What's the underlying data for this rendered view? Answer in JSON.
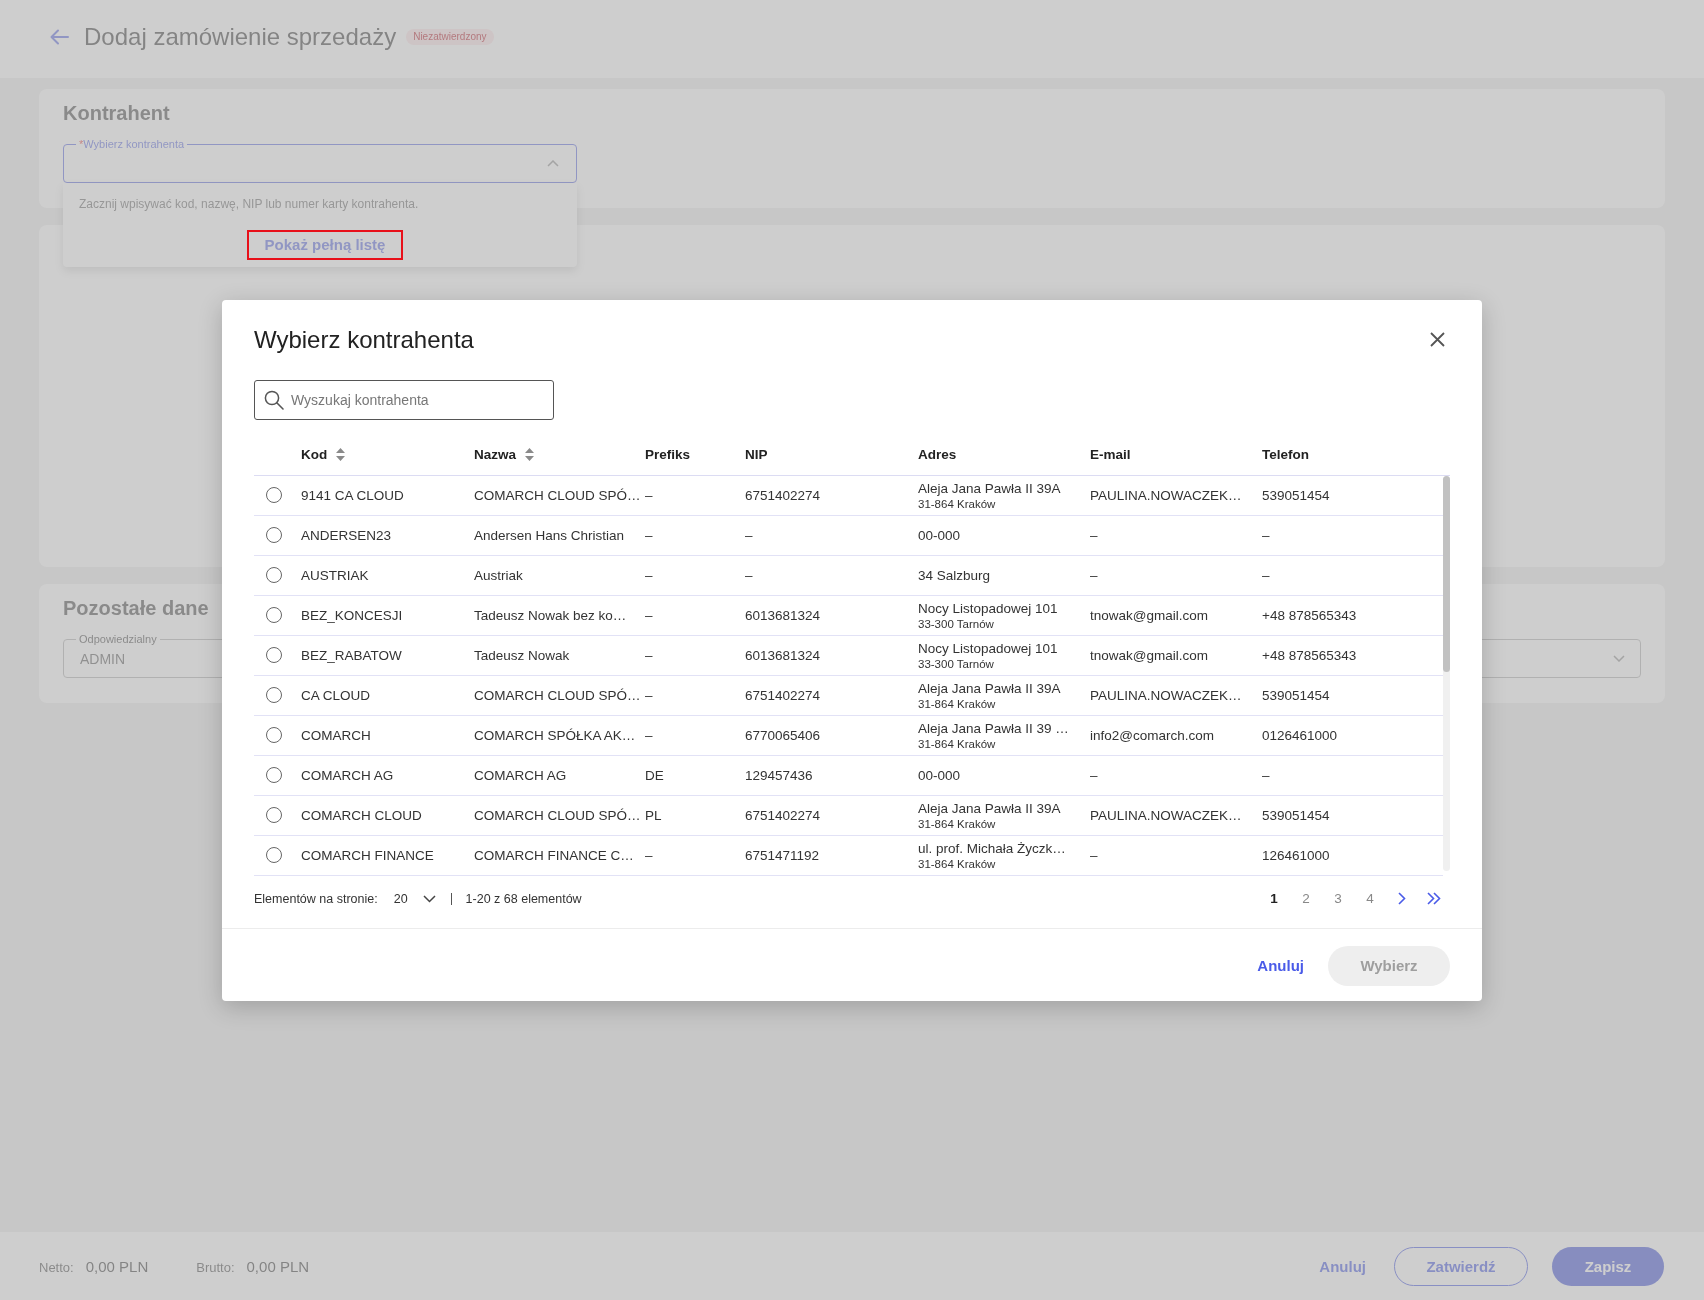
{
  "header": {
    "title": "Dodaj zamówienie sprzedaży",
    "status_badge": "Niezatwierdzony"
  },
  "contractor_section": {
    "title": "Kontrahent",
    "select": {
      "required_mark": "*",
      "label": "Wybierz kontrahenta",
      "expanded": true
    },
    "dropdown": {
      "hint": "Zacznij wpisywać kod, nazwę, NIP lub numer karty kontrahenta.",
      "link": {
        "label": "Pokaż pełną listę",
        "highlighted": true
      }
    }
  },
  "other_section": {
    "title": "Pozostałe dane",
    "fields": [
      {
        "kind": "text",
        "label": "Odpowiedzialny",
        "value": "ADMIN",
        "disabled": true
      },
      {
        "kind": "select"
      }
    ]
  },
  "bottom_bar": {
    "totals": [
      {
        "label": "Netto:",
        "value": "0,00 PLN"
      },
      {
        "label": "Brutto:",
        "value": "0,00 PLN"
      }
    ],
    "buttons": [
      {
        "kind": "link",
        "label": "Anuluj"
      },
      {
        "kind": "outlined",
        "label": "Zatwierdź"
      },
      {
        "kind": "primary",
        "label": "Zapisz"
      }
    ]
  },
  "dialog": {
    "title": "Wybierz kontrahenta",
    "search": {
      "placeholder": "Wyszukaj kontrahenta"
    },
    "table": {
      "columns": [
        {
          "label": "Kod",
          "kind": "sortable"
        },
        {
          "label": "Nazwa",
          "kind": "sortable"
        },
        {
          "label": "Prefiks",
          "kind": "plain"
        },
        {
          "label": "NIP",
          "kind": "plain"
        },
        {
          "label": "Adres",
          "kind": "plain"
        },
        {
          "label": "E-mail",
          "kind": "plain"
        },
        {
          "label": "Telefon",
          "kind": "plain"
        }
      ],
      "rows": [
        {
          "selected": false,
          "cells": [
            "9141 CA CLOUD",
            "COMARCH CLOUD SPÓ…",
            "–",
            "6751402274",
            [
              "Aleja Jana Pawła II 39A",
              "31-864 Kraków"
            ],
            "PAULINA.NOWACZEK…",
            "539051454"
          ]
        },
        {
          "selected": false,
          "cells": [
            "ANDERSEN23",
            "Andersen Hans Christian",
            "–",
            "–",
            [
              "00-000"
            ],
            "–",
            "–"
          ]
        },
        {
          "selected": false,
          "cells": [
            "AUSTRIAK",
            "Austriak",
            "–",
            "–",
            [
              "34 Salzburg"
            ],
            "–",
            "–"
          ]
        },
        {
          "selected": false,
          "cells": [
            "BEZ_KONCESJI",
            "Tadeusz Nowak bez ko…",
            "–",
            "6013681324",
            [
              "Nocy Listopadowej 101",
              "33-300 Tarnów"
            ],
            "tnowak@gmail.com",
            "+48 878565343"
          ]
        },
        {
          "selected": false,
          "cells": [
            "BEZ_RABATOW",
            "Tadeusz Nowak",
            "–",
            "6013681324",
            [
              "Nocy Listopadowej 101",
              "33-300 Tarnów"
            ],
            "tnowak@gmail.com",
            "+48 878565343"
          ]
        },
        {
          "selected": false,
          "cells": [
            "CA CLOUD",
            "COMARCH CLOUD SPÓ…",
            "–",
            "6751402274",
            [
              "Aleja Jana Pawła II 39A",
              "31-864 Kraków"
            ],
            "PAULINA.NOWACZEK…",
            "539051454"
          ]
        },
        {
          "selected": false,
          "cells": [
            "COMARCH",
            "COMARCH SPÓŁKA AK…",
            "–",
            "6770065406",
            [
              "Aleja Jana Pawła II 39 …",
              "31-864 Kraków"
            ],
            "info2@comarch.com",
            "0126461000"
          ]
        },
        {
          "selected": false,
          "cells": [
            "COMARCH AG",
            "COMARCH AG",
            "DE",
            "129457436",
            [
              "00-000"
            ],
            "–",
            "–"
          ]
        },
        {
          "selected": false,
          "cells": [
            "COMARCH CLOUD",
            "COMARCH CLOUD SPÓ…",
            "PL",
            "6751402274",
            [
              "Aleja Jana Pawła II 39A",
              "31-864 Kraków"
            ],
            "PAULINA.NOWACZEK…",
            "539051454"
          ]
        },
        {
          "selected": false,
          "cells": [
            "COMARCH FINANCE",
            "COMARCH FINANCE C…",
            "–",
            "6751471192",
            [
              "ul. prof. Michała Życzk…",
              "31-864 Kraków"
            ],
            "–",
            "126461000"
          ]
        }
      ]
    },
    "pagination": {
      "page_size_label": "Elementów na stronie:",
      "page_size": "20",
      "range": "1-20 z 68 elementów",
      "pages": [
        {
          "label": "1",
          "selected": true
        },
        {
          "label": "2",
          "selected": false
        },
        {
          "label": "3",
          "selected": false
        },
        {
          "label": "4",
          "selected": false
        }
      ]
    },
    "buttons": [
      {
        "kind": "link",
        "label": "Anuluj",
        "disabled": false
      },
      {
        "kind": "primary",
        "label": "Wybierz",
        "disabled": true
      }
    ]
  }
}
